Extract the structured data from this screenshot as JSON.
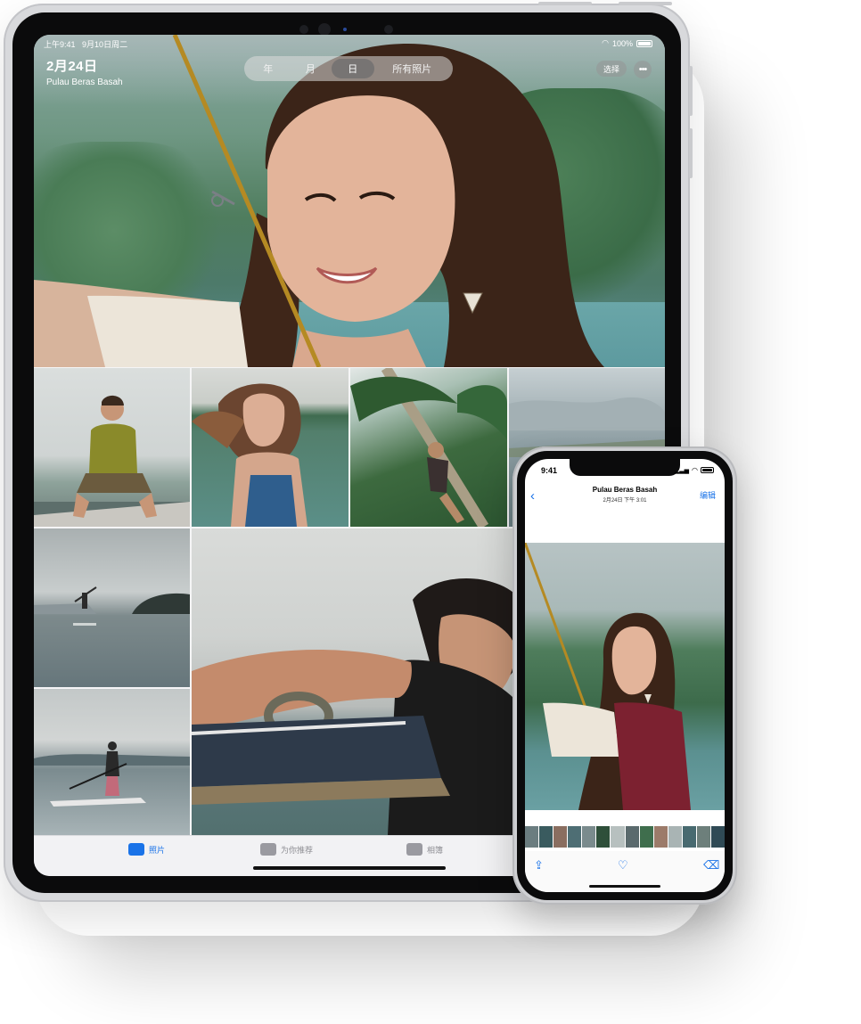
{
  "ipad": {
    "status": {
      "time": "上午9:41",
      "date": "9月10日周二",
      "battery": "100%"
    },
    "header": {
      "title": "2月24日",
      "subtitle": "Pulau Beras Basah"
    },
    "segments": [
      "年",
      "月",
      "日",
      "所有照片"
    ],
    "active_segment": "日",
    "select_label": "选择",
    "more_label": "•••",
    "tabs": [
      {
        "label": "照片",
        "icon": "photos-icon",
        "active": true
      },
      {
        "label": "为你推荐",
        "icon": "for-you-icon",
        "active": false
      },
      {
        "label": "相簿",
        "icon": "albums-icon",
        "active": false
      }
    ]
  },
  "iphone": {
    "status": {
      "time": "9:41"
    },
    "nav": {
      "back": "‹",
      "title": "Pulau Beras Basah",
      "subtitle": "2月24日  下午 3:01",
      "edit": "编辑"
    },
    "toolbar": {
      "share_icon": "share-icon",
      "favorite_icon": "heart-icon",
      "delete_icon": "trash-icon"
    }
  },
  "colors": {
    "accent": "#1a73e8",
    "tab_inactive": "#8e8e93"
  }
}
